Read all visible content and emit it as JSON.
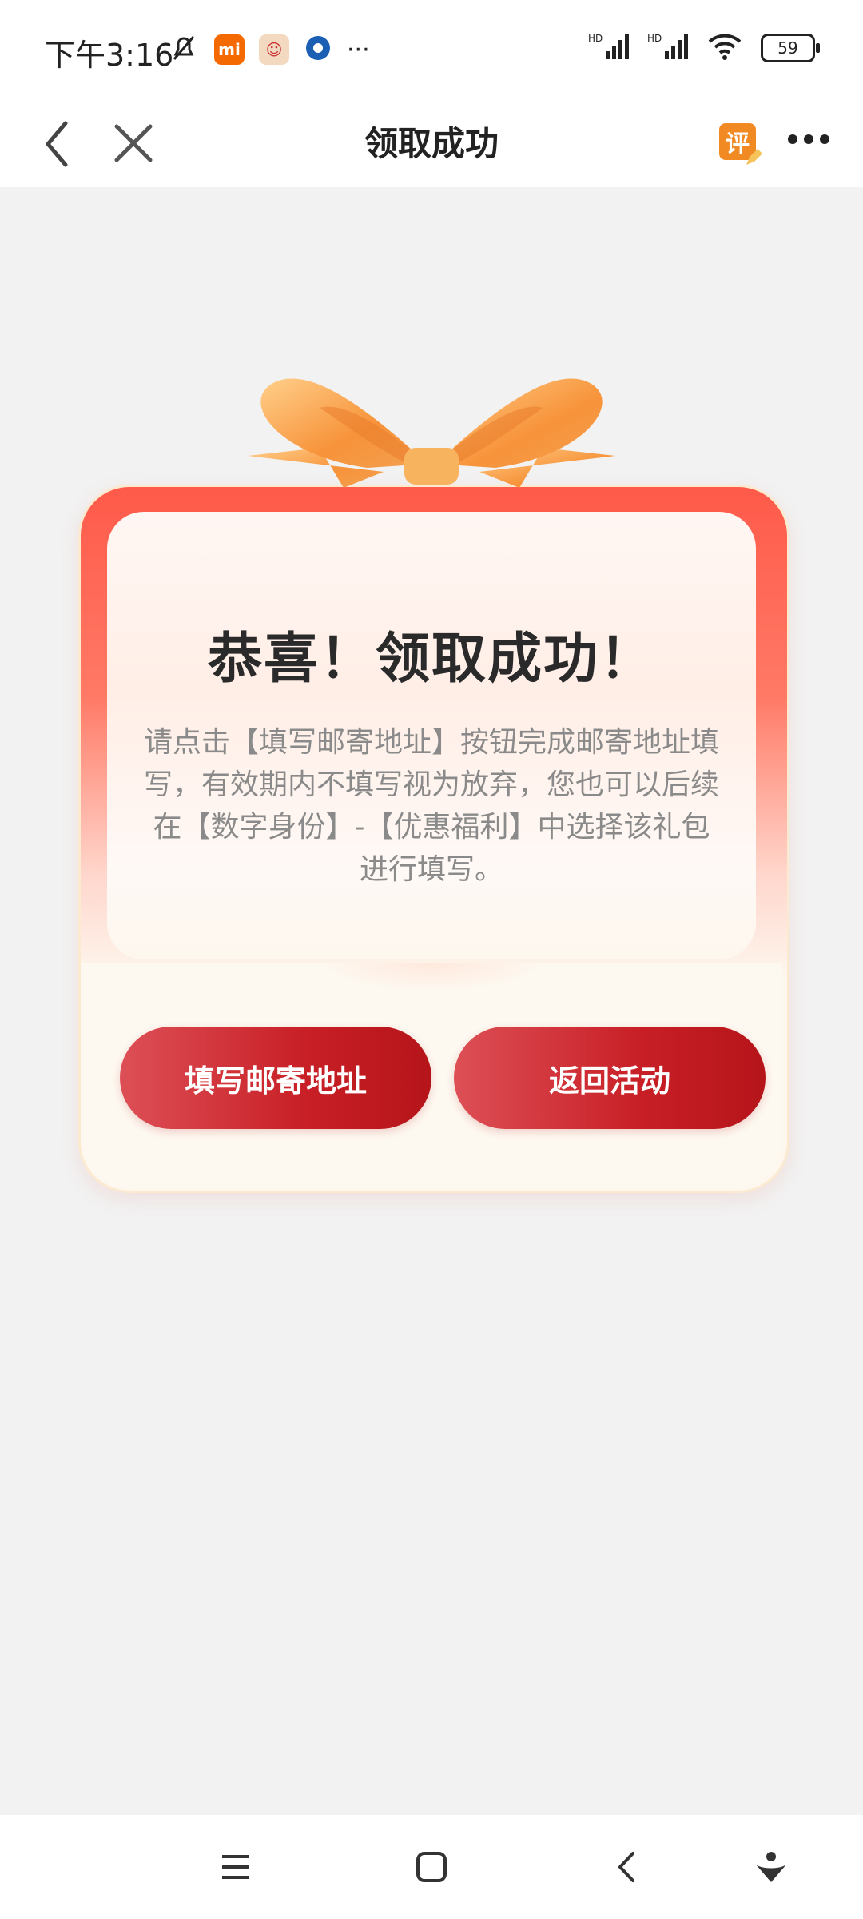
{
  "status_bar": {
    "time": "下午3:16",
    "battery": "59",
    "network": "HD"
  },
  "header": {
    "title": "领取成功",
    "review_badge": "评"
  },
  "card": {
    "headline": "恭喜！领取成功！",
    "description": "请点击【填写邮寄地址】按钮完成邮寄地址填写，有效期内不填写视为放弃，您也可以后续在【数字身份】-【优惠福利】中选择该礼包进行填写。",
    "primary_button": "填写邮寄地址",
    "secondary_button": "返回活动"
  },
  "colors": {
    "accent": "#c81f26",
    "card_top": "#ff5a4a",
    "ribbon": "#f7a04a"
  }
}
